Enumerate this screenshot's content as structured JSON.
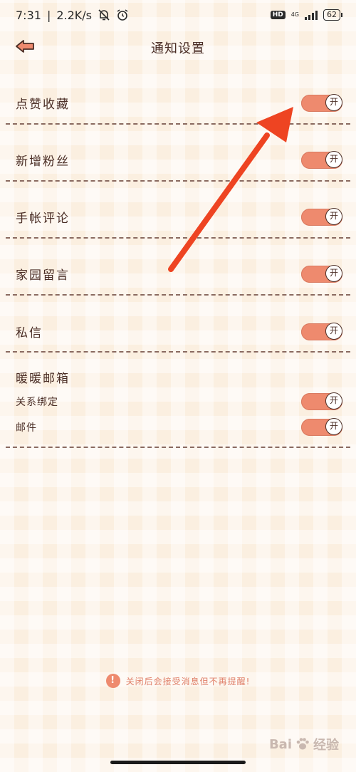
{
  "status": {
    "time": "7:31",
    "speed": "2.2K/s",
    "hd": "HD",
    "network": "4G",
    "battery": "62"
  },
  "header": {
    "title": "通知设置"
  },
  "settings": [
    {
      "label": "点赞收藏",
      "toggle": "开"
    },
    {
      "label": "新增粉丝",
      "toggle": "开"
    },
    {
      "label": "手帐评论",
      "toggle": "开"
    },
    {
      "label": "家园留言",
      "toggle": "开"
    },
    {
      "label": "私信",
      "toggle": "开"
    }
  ],
  "mailbox": {
    "title": "暖暖邮箱",
    "items": [
      {
        "label": "关系绑定",
        "toggle": "开"
      },
      {
        "label": "邮件",
        "toggle": "开"
      }
    ]
  },
  "footer": {
    "icon": "!",
    "note": "关闭后会接受消息但不再提醒!"
  },
  "watermark": {
    "text": "Bai",
    "suffix": "经验"
  },
  "colors": {
    "accent": "#ee8a6e",
    "arrow": "#ee4422",
    "background": "#fbefe0"
  }
}
